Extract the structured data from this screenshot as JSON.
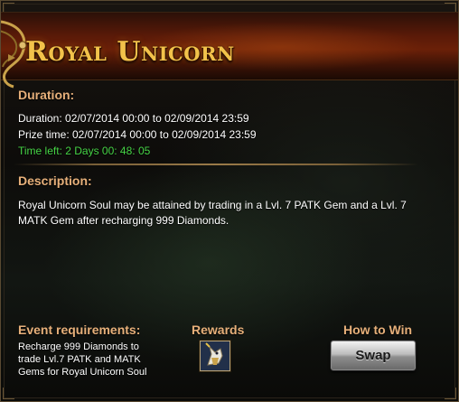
{
  "event": {
    "title": "Royal Unicorn",
    "duration_heading": "Duration:",
    "duration_line": "Duration: 02/07/2014 00:00 to 02/09/2014 23:59",
    "prize_line": "Prize time: 02/07/2014 00:00 to 02/09/2014 23:59",
    "time_left": "Time left: 2  Days  00: 48: 05",
    "description_heading": "Description:",
    "description_text": "Royal Unicorn Soul may be attained by trading in a Lvl. 7 PATK Gem and a Lvl. 7 MATK Gem after recharging 999 Diamonds."
  },
  "footer": {
    "requirements_heading": "Event requirements:",
    "requirements_text": "Recharge 999 Diamonds to trade Lvl.7 PATK and MATK Gems for Royal Unicorn Soul",
    "rewards_heading": "Rewards",
    "reward_icon": "royal-unicorn-soul-icon",
    "how_to_win_heading": "How to Win",
    "swap_label": "Swap"
  },
  "colors": {
    "heading": "#e7b07a",
    "title": "#f2c24a",
    "time_left": "#46d446",
    "text": "#ffffff"
  }
}
